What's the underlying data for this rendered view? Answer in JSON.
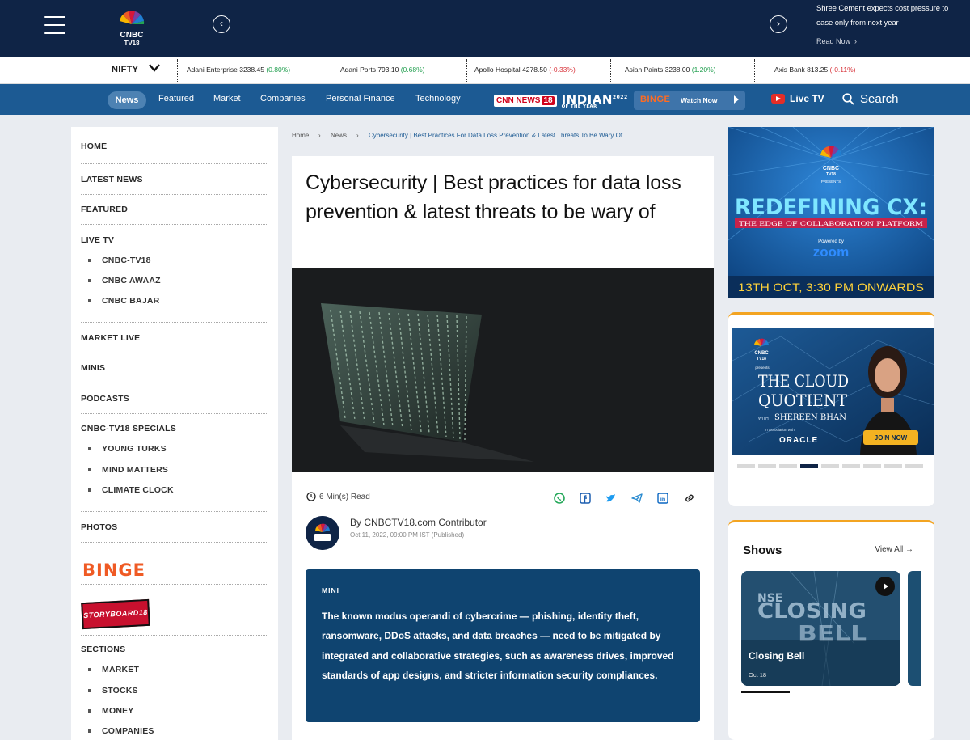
{
  "header": {
    "logo_line1": "CNBC",
    "logo_line2": "TV18",
    "promo_text": "Shree Cement expects cost pressure to ease only from next year",
    "promo_link": "Read Now"
  },
  "ticker": {
    "index_label": "NIFTY",
    "items": [
      {
        "name": "Adani Enterprise",
        "price": "3238.45",
        "change": "(0.80%)",
        "dir": "up"
      },
      {
        "name": "Adani Ports",
        "price": "793.10",
        "change": "(0.68%)",
        "dir": "up"
      },
      {
        "name": "Apollo Hospital",
        "price": "4278.50",
        "change": "(-0.33%)",
        "dir": "down"
      },
      {
        "name": "Asian Paints",
        "price": "3238.00",
        "change": "(1.20%)",
        "dir": "up"
      },
      {
        "name": "Axis Bank",
        "price": "813.25",
        "change": "(-0.11%)",
        "dir": "down"
      }
    ]
  },
  "nav": {
    "active": "News",
    "items": [
      "Featured",
      "Market",
      "Companies",
      "Personal Finance",
      "Technology"
    ],
    "cnn_label": "CNN",
    "cnn_news": "NEWS",
    "cnn_18": "18",
    "ioty_title": "INDIAN",
    "ioty_sub": "OF THE YEAR",
    "ioty_year": "2022",
    "binge_label": "BINGE",
    "watch_now": "Watch Now",
    "live_tv": "Live TV",
    "search": "Search"
  },
  "sidebar": {
    "home": "HOME",
    "latest": "LATEST NEWS",
    "featured": "FEATURED",
    "live_tv": "LIVE TV",
    "live_subs": [
      "CNBC-TV18",
      "CNBC AWAAZ",
      "CNBC BAJAR"
    ],
    "market_live": "MARKET LIVE",
    "minis": "MINIS",
    "podcasts": "PODCASTS",
    "specials": "CNBC-TV18 SPECIALS",
    "special_subs": [
      "YOUNG TURKS",
      "MIND MATTERS",
      "CLIMATE CLOCK"
    ],
    "photos": "PHOTOS",
    "binge_logo": "BINGE",
    "storyboard_logo": "STORYBOARD18",
    "sections": "SECTIONS",
    "section_subs": [
      "MARKET",
      "STOCKS",
      "MONEY",
      "COMPANIES"
    ]
  },
  "breadcrumb": {
    "home": "Home",
    "news": "News",
    "current": "Cybersecurity | Best Practices For Data Loss Prevention & Latest Threats To Be Wary Of"
  },
  "article": {
    "headline": "Cybersecurity | Best practices for data loss prevention & latest threats to be wary of",
    "read_time": "6 Min(s) Read",
    "author": "By CNBCTV18.com Contributor",
    "published": "Oct 11, 2022, 09:00 PM IST (Published)",
    "mini_label": "MINI",
    "mini_text": "The known modus operandi of cybercrime — phishing, identity theft, ransomware, DDoS attacks, and data breaches — need to be mitigated by integrated and collaborative strategies, such as awareness drives, improved standards of app designs, and stricter information security compliances."
  },
  "ads": {
    "ad1_presents": "PRESENTS",
    "ad1_title": "REDEFINING CX:",
    "ad1_subtitle": "THE EDGE OF COLLABORATION PLATFORM",
    "ad1_powered": "Powered by",
    "ad1_zoom": "zoom",
    "ad1_date": "13TH OCT, 3:30 PM ONWARDS",
    "ad2_presents": "presents",
    "ad2_title1": "THE CLOUD",
    "ad2_title2": "QUOTIENT",
    "ad2_with": "WITH",
    "ad2_host": "SHEREEN BHAN",
    "ad2_assoc": "In association with",
    "ad2_oracle": "ORACLE",
    "ad2_join": "JOIN NOW",
    "carousel_active_index": 3,
    "carousel_total": 9
  },
  "shows": {
    "title": "Shows",
    "view_all": "View All",
    "tile_brand": "NSE",
    "tile_line1": "CLOSING",
    "tile_line2": "BELL",
    "name": "Closing Bell",
    "date": "Oct 18"
  },
  "colors": {
    "header_bg": "#0f2446",
    "nav_bg": "#1c5a93",
    "mini_bg": "#0f4470",
    "accent_orange": "#f3a421"
  }
}
